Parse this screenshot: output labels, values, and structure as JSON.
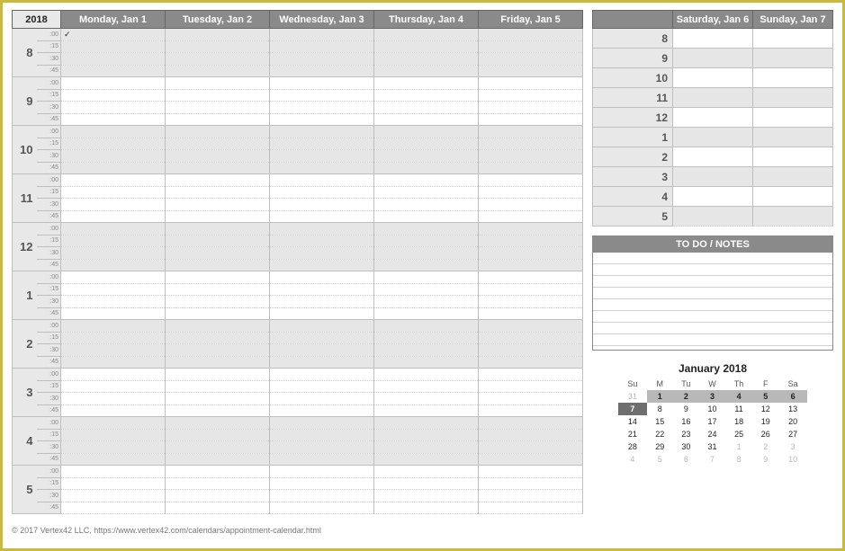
{
  "year": "2018",
  "weekday_headers": [
    "Monday, Jan 1",
    "Tuesday, Jan 2",
    "Wednesday, Jan 3",
    "Thursday, Jan 4",
    "Friday, Jan 5"
  ],
  "weekend_headers": [
    "Saturday, Jan 6",
    "Sunday, Jan 7"
  ],
  "hours": [
    "8",
    "9",
    "10",
    "11",
    "12",
    "1",
    "2",
    "3",
    "4",
    "5"
  ],
  "subdivisions": [
    ":00",
    ":15",
    ":30",
    ":45"
  ],
  "weekend_hours": [
    "8",
    "9",
    "10",
    "11",
    "12",
    "1",
    "2",
    "3",
    "4",
    "5"
  ],
  "checkmark": "✓",
  "todo_label": "TO DO  /  NOTES",
  "mini": {
    "title": "January 2018",
    "dow": [
      "Su",
      "M",
      "Tu",
      "W",
      "Th",
      "F",
      "Sa"
    ],
    "rows": [
      [
        {
          "v": "31",
          "cls": "other"
        },
        {
          "v": "1",
          "cls": "hl"
        },
        {
          "v": "2",
          "cls": "hl"
        },
        {
          "v": "3",
          "cls": "hl"
        },
        {
          "v": "4",
          "cls": "hl"
        },
        {
          "v": "5",
          "cls": "hl"
        },
        {
          "v": "6",
          "cls": "hl"
        }
      ],
      [
        {
          "v": "7",
          "cls": "hl-dark"
        },
        {
          "v": "8",
          "cls": ""
        },
        {
          "v": "9",
          "cls": ""
        },
        {
          "v": "10",
          "cls": ""
        },
        {
          "v": "11",
          "cls": ""
        },
        {
          "v": "12",
          "cls": ""
        },
        {
          "v": "13",
          "cls": ""
        }
      ],
      [
        {
          "v": "14",
          "cls": ""
        },
        {
          "v": "15",
          "cls": ""
        },
        {
          "v": "16",
          "cls": ""
        },
        {
          "v": "17",
          "cls": ""
        },
        {
          "v": "18",
          "cls": ""
        },
        {
          "v": "19",
          "cls": ""
        },
        {
          "v": "20",
          "cls": ""
        }
      ],
      [
        {
          "v": "21",
          "cls": ""
        },
        {
          "v": "22",
          "cls": ""
        },
        {
          "v": "23",
          "cls": ""
        },
        {
          "v": "24",
          "cls": ""
        },
        {
          "v": "25",
          "cls": ""
        },
        {
          "v": "26",
          "cls": ""
        },
        {
          "v": "27",
          "cls": ""
        }
      ],
      [
        {
          "v": "28",
          "cls": ""
        },
        {
          "v": "29",
          "cls": ""
        },
        {
          "v": "30",
          "cls": ""
        },
        {
          "v": "31",
          "cls": ""
        },
        {
          "v": "1",
          "cls": "other"
        },
        {
          "v": "2",
          "cls": "other"
        },
        {
          "v": "3",
          "cls": "other"
        }
      ],
      [
        {
          "v": "4",
          "cls": "other"
        },
        {
          "v": "5",
          "cls": "other"
        },
        {
          "v": "6",
          "cls": "other"
        },
        {
          "v": "7",
          "cls": "other"
        },
        {
          "v": "8",
          "cls": "other"
        },
        {
          "v": "9",
          "cls": "other"
        },
        {
          "v": "10",
          "cls": "other"
        }
      ]
    ]
  },
  "footer": "© 2017 Vertex42 LLC, https://www.vertex42.com/calendars/appointment-calendar.html"
}
